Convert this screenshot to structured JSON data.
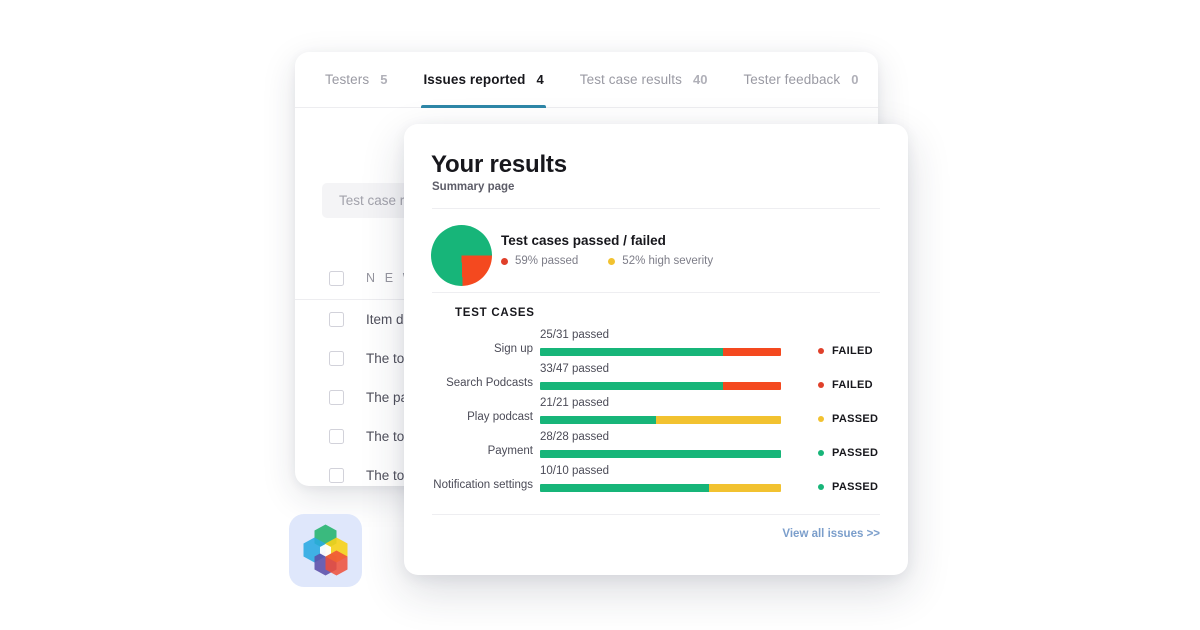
{
  "back_card": {
    "tabs": [
      {
        "label": "Testers",
        "count": "5",
        "active": false
      },
      {
        "label": "Issues reported",
        "count": "4",
        "active": true
      },
      {
        "label": "Test case results",
        "count": "40",
        "active": false
      },
      {
        "label": "Tester feedback",
        "count": "0",
        "active": false
      }
    ],
    "search": {
      "placeholder": "Test case re",
      "icon": "search-icon"
    },
    "list": [
      {
        "text": "N E W   I",
        "section": true
      },
      {
        "text": "Item doe",
        "section": false
      },
      {
        "text": "The tota",
        "section": false
      },
      {
        "text": "The pay",
        "section": false
      },
      {
        "text": "The tota",
        "section": false
      },
      {
        "text": "The tota",
        "section": false
      }
    ]
  },
  "front_card": {
    "title": "Your results",
    "subtitle": "Summary page",
    "summary": {
      "title": "Test cases passed / failed",
      "legend": [
        {
          "label": "59% passed",
          "color": "#e0402a"
        },
        {
          "label": "52% high severity",
          "color": "#f2c230"
        }
      ]
    },
    "testcases_heading": "TEST CASES",
    "view_all_link": "View all issues >>"
  },
  "chart_data": [
    {
      "type": "pie",
      "title": "Test cases passed / failed",
      "labels": [
        "passed",
        "failed"
      ],
      "values": [
        75.5,
        24.5
      ],
      "colors": [
        "#17b579",
        "#f4491f"
      ],
      "legend": [
        "59% passed",
        "52% high severity"
      ],
      "legend_position": "bottom"
    },
    {
      "type": "bar",
      "title": "TEST CASES",
      "orientation": "horizontal",
      "stacked": true,
      "categories": [
        "Sign up",
        "Search Podcasts",
        "Play podcast",
        "Payment",
        "Notification settings"
      ],
      "captions": [
        "25/31 passed",
        "33/47 passed",
        "21/21 passed",
        "28/28 passed",
        "10/10 passed"
      ],
      "statuses": [
        "FAILED",
        "FAILED",
        "PASSED",
        "PASSED",
        "PASSED"
      ],
      "status_colors": [
        "#e0402a",
        "#e0402a",
        "#f2c230",
        "#17b579",
        "#17b579"
      ],
      "series": [
        {
          "name": "passed",
          "color": "#17b579",
          "values": [
            76,
            76,
            48,
            100,
            70
          ]
        },
        {
          "name": "failed",
          "color": "#f4491f",
          "values": [
            24,
            24,
            0,
            0,
            0
          ]
        },
        {
          "name": "high severity",
          "color": "#f2c230",
          "values": [
            0,
            0,
            52,
            0,
            30
          ]
        }
      ],
      "xlim": [
        0,
        100
      ],
      "grid": false
    }
  ],
  "rows": [
    {
      "label": "Sign up",
      "caption": "25/31 passed",
      "segments": [
        {
          "color": "#17b579",
          "pct": 76
        },
        {
          "color": "#f4491f",
          "pct": 24
        }
      ],
      "status": "FAILED",
      "status_color": "#e0402a"
    },
    {
      "label": "Search Podcasts",
      "caption": "33/47 passed",
      "segments": [
        {
          "color": "#17b579",
          "pct": 76
        },
        {
          "color": "#f4491f",
          "pct": 24
        }
      ],
      "status": "FAILED",
      "status_color": "#e0402a"
    },
    {
      "label": "Play podcast",
      "caption": "21/21 passed",
      "segments": [
        {
          "color": "#17b579",
          "pct": 48
        },
        {
          "color": "#f2c230",
          "pct": 52
        }
      ],
      "status": "PASSED",
      "status_color": "#f2c230"
    },
    {
      "label": "Payment",
      "caption": "28/28 passed",
      "segments": [
        {
          "color": "#17b579",
          "pct": 100
        }
      ],
      "status": "PASSED",
      "status_color": "#17b579"
    },
    {
      "label": "Notification settings",
      "caption": "10/10 passed",
      "segments": [
        {
          "color": "#17b579",
          "pct": 70
        },
        {
          "color": "#f2c230",
          "pct": 30
        }
      ],
      "status": "PASSED",
      "status_color": "#17b579"
    }
  ],
  "logo": {
    "name": "hexagon-logo-icon",
    "badge_color": "#dfe7fb",
    "colors": [
      "#2bb673",
      "#29aae1",
      "#5b4fa8",
      "#f7d117",
      "#f04e37",
      "#ffffff"
    ]
  }
}
